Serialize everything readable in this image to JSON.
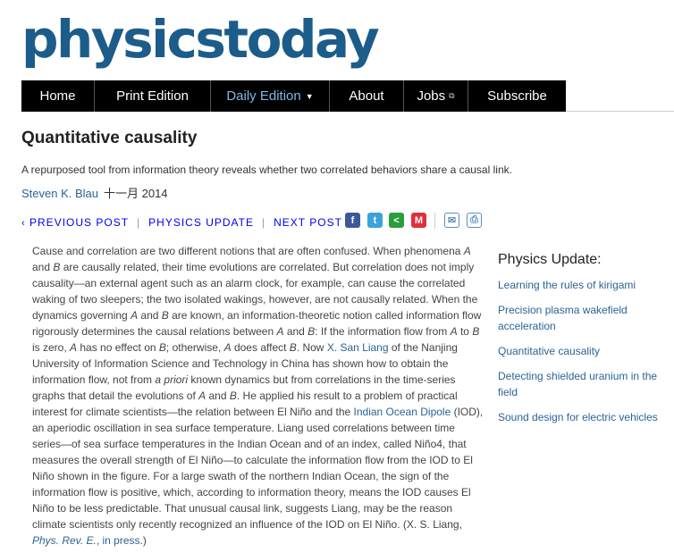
{
  "logo": "physicstoday",
  "nav": [
    {
      "label": "Home"
    },
    {
      "label": "Print Edition"
    },
    {
      "label": "Daily Edition"
    },
    {
      "label": "About"
    },
    {
      "label": "Jobs"
    },
    {
      "label": "Subscribe"
    }
  ],
  "article": {
    "title": "Quantitative causality",
    "subtitle": "A repurposed tool from information theory reveals whether two correlated behaviors share a causal link.",
    "author": "Steven K. Blau",
    "date": "十一月 2014",
    "body": {
      "p1": "Cause and correlation are two different notions that are often confused. When phenomena ",
      "A": "A",
      "and": " and ",
      "B": "B",
      "p2": " are causally related, their time evolutions are correlated. But correlation does not imply causality—an external agent such as an alarm clock, for example, can cause the correlated waking of two sleepers; the two isolated wakings, however, are not causally related. When the dynamics governing ",
      "p3": " are known, an information-theoretic notion called information flow rigorously determines the causal relations between ",
      "p4": ": If the information flow from ",
      "to": " to ",
      "p5": " is zero, ",
      "p6": " has no effect on ",
      "p7": "; otherwise, ",
      "p8": " does affect ",
      "p9": ". Now ",
      "liang_link": "X. San Liang",
      "p10": " of the Nanjing University of Information Science and Technology in China has shown how to obtain the information flow, not from ",
      "apriori": "a priori",
      "p11": " known dynamics but from correlations in the time-series graphs that detail the evolutions of ",
      "p12": ". He applied his result to a problem of practical interest for climate scientists—the relation between El Niño and the ",
      "iod_link": "Indian Ocean Dipole",
      "p13": " (IOD), an aperiodic oscillation in sea surface temperature. Liang used correlations between time series—of sea surface temperatures in the Indian Ocean and of an index, called Niño4, that measures the overall strength of El Niño—to calculate the information flow from the IOD to El Niño shown in the figure. For a large swath of the northern Indian Ocean, the sign of the information flow is positive, which, according to information theory, means the IOD causes El Niño to be less predictable. That unusual causal link, suggests Liang, may be the reason climate scientists only recently recognized an influence of the IOD on El Niño. (X. S. Liang, ",
      "ref_link": "Phys. Rev. E.",
      "ref_rest": ", in press",
      "p14": ".)"
    }
  },
  "postnav": {
    "prev": "PREVIOUS POST",
    "section": "PHYSICS UPDATE",
    "next": "NEXT POST",
    "sep": "|"
  },
  "share": {
    "facebook": "f",
    "twitter": "t",
    "share": "<",
    "mendeley": "M",
    "email": "✉",
    "print": "⎙"
  },
  "sidebar": {
    "heading": "Physics Update:",
    "items": [
      "Learning the rules of kirigami",
      "Precision plasma wakefield acceleration",
      "Quantitative causality",
      "Detecting shielded uranium in the field",
      "Sound design for electric vehicles"
    ]
  },
  "colors": {
    "brand": "#1c5c8a",
    "link": "#2a6496",
    "nav_bg": "#000000",
    "nav_active": "#7fb8e6"
  }
}
